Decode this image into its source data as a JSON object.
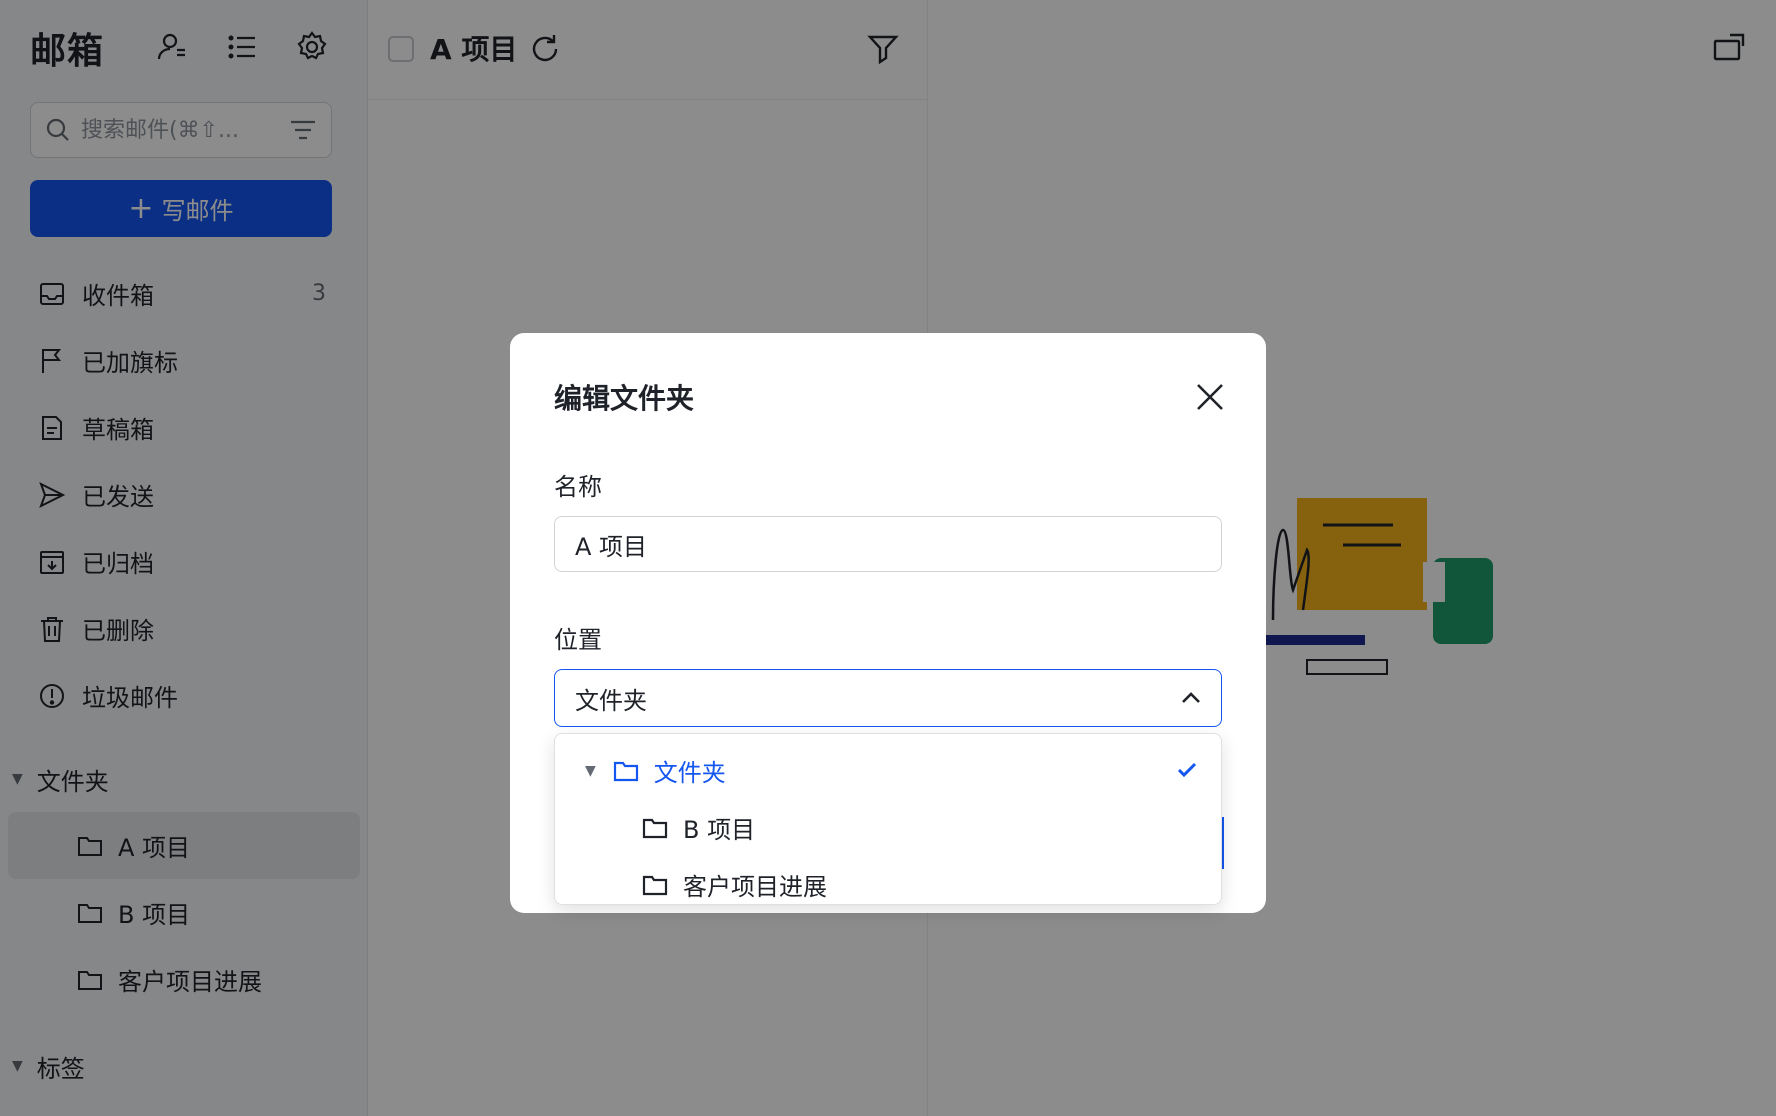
{
  "sidebar": {
    "title": "邮箱",
    "tools": [
      "contacts-icon",
      "list-icon",
      "settings-icon"
    ],
    "search": {
      "placeholder": "搜索邮件(⌘⇧..."
    },
    "compose_label": "写邮件",
    "nav": [
      {
        "label": "收件箱",
        "icon": "inbox-icon",
        "count": "3"
      },
      {
        "label": "已加旗标",
        "icon": "flag-icon",
        "count": ""
      },
      {
        "label": "草稿箱",
        "icon": "draft-icon",
        "count": ""
      },
      {
        "label": "已发送",
        "icon": "send-icon",
        "count": ""
      },
      {
        "label": "已归档",
        "icon": "archive-icon",
        "count": ""
      },
      {
        "label": "已删除",
        "icon": "trash-icon",
        "count": ""
      },
      {
        "label": "垃圾邮件",
        "icon": "spam-icon",
        "count": ""
      }
    ],
    "folders_heading": "文件夹",
    "folders": [
      {
        "label": "A 项目",
        "active": true
      },
      {
        "label": "B 项目",
        "active": false
      },
      {
        "label": "客户项目进展",
        "active": false
      }
    ],
    "tags_heading": "标签"
  },
  "list": {
    "title": "A 项目"
  },
  "modal": {
    "title": "编辑文件夹",
    "name_label": "名称",
    "name_value": "A 项目",
    "location_label": "位置",
    "location_value": "文件夹",
    "options": [
      {
        "label": "文件夹",
        "selected": true,
        "level": 0
      },
      {
        "label": "B 项目",
        "selected": false,
        "level": 1
      },
      {
        "label": "客户项目进展",
        "selected": false,
        "level": 1
      }
    ]
  },
  "colors": {
    "accent": "#1456f0",
    "illustration_yellow": "#f5b21c",
    "illustration_green": "#1f9c6b"
  }
}
